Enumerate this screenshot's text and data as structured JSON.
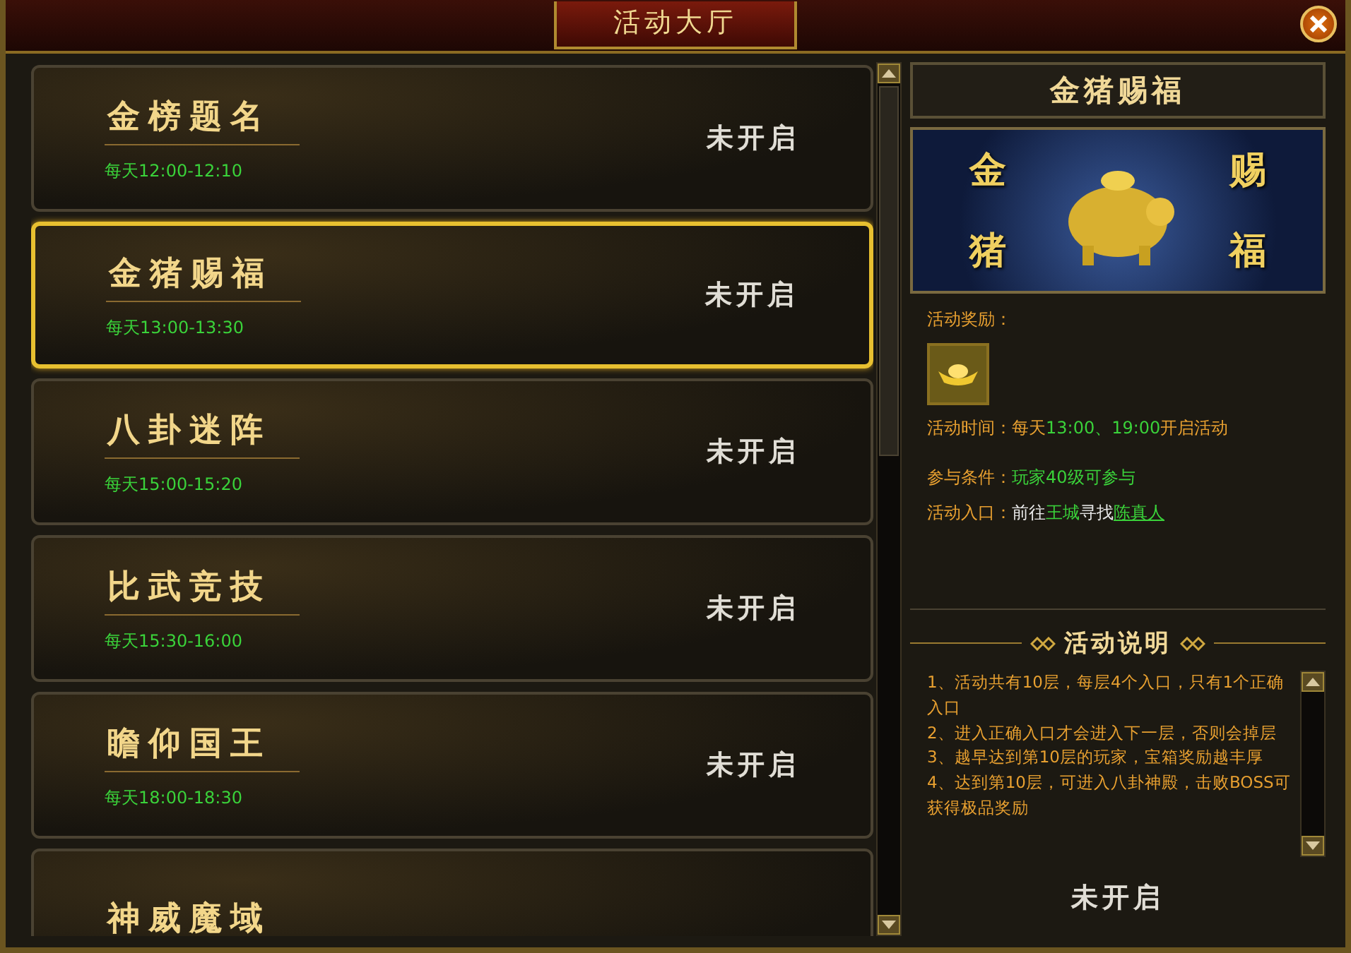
{
  "window": {
    "title": "活动大厅"
  },
  "activities": [
    {
      "name": "金榜题名",
      "time": "每天12:00-12:10",
      "status": "未开启",
      "selected": false
    },
    {
      "name": "金猪赐福",
      "time": "每天13:00-13:30",
      "status": "未开启",
      "selected": true
    },
    {
      "name": "八卦迷阵",
      "time": "每天15:00-15:20",
      "status": "未开启",
      "selected": false
    },
    {
      "name": "比武竞技",
      "time": "每天15:30-16:00",
      "status": "未开启",
      "selected": false
    },
    {
      "name": "瞻仰国王",
      "time": "每天18:00-18:30",
      "status": "未开启",
      "selected": false
    },
    {
      "name": "神威魔域",
      "selected": false
    }
  ],
  "detail": {
    "title": "金猪赐福",
    "banner_text": [
      "金",
      "赐",
      "猪",
      "福"
    ],
    "reward_label": "活动奖励：",
    "info": [
      {
        "label": "活动时间：",
        "parts": [
          {
            "text": "每天",
            "kind": "label"
          },
          {
            "text": "13:00、19:00",
            "kind": "highlight"
          },
          {
            "text": "开启活动",
            "kind": "label"
          }
        ]
      },
      {
        "label": "参与条件：",
        "parts": [
          {
            "text": "玩家40级可参与",
            "kind": "highlight"
          }
        ]
      },
      {
        "label": "活动入口：",
        "parts": [
          {
            "text": "前往",
            "kind": "plain"
          },
          {
            "text": "王城",
            "kind": "highlight"
          },
          {
            "text": "寻找",
            "kind": "plain"
          },
          {
            "text": "陈真人",
            "kind": "link"
          }
        ]
      }
    ],
    "description_title": "活动说明",
    "description": [
      "1、活动共有10层，每层4个入口，只有1个正确入口",
      "2、进入正确入口才会进入下一层，否则会掉层",
      "3、越早达到第10层的玩家，宝箱奖励越丰厚",
      "4、达到第10层，可进入八卦神殿，击败BOSS可获得极品奖励"
    ],
    "status": "未开启"
  }
}
